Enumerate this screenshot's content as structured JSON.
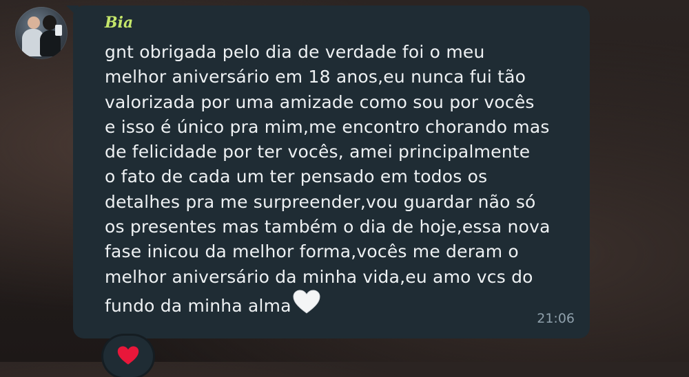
{
  "chat": {
    "sender_name": "Bia",
    "avatar_icon": "profile-photo-icon",
    "message_lines": [
      "gnt obrigada pelo dia de verdade foi o meu",
      "melhor aniversário em 18 anos,eu nunca fui tão",
      "valorizada por uma amizade como sou por vocês",
      "e isso é único pra mim,me encontro chorando mas",
      "de felicidade por ter vocês, amei principalmente",
      "o fato de cada um ter pensado em todos os",
      "detalhes pra me surpreender,vou guardar não só",
      "os presentes mas também o dia de hoje,essa nova",
      "fase inicou da melhor forma,vocês me deram o",
      "melhor aniversário da minha vida,eu amo vcs do",
      "fundo da minha alma"
    ],
    "trailing_emoji": "white-heart-icon",
    "timestamp": "21:06",
    "reaction_icon": "red-heart-icon"
  },
  "colors": {
    "bubble_bg": "#1f2c34",
    "sender_name": "#c4e66a",
    "message_text": "#eef1f3",
    "timestamp": "#8fa0ab",
    "reaction_heart": "#e8173a"
  }
}
